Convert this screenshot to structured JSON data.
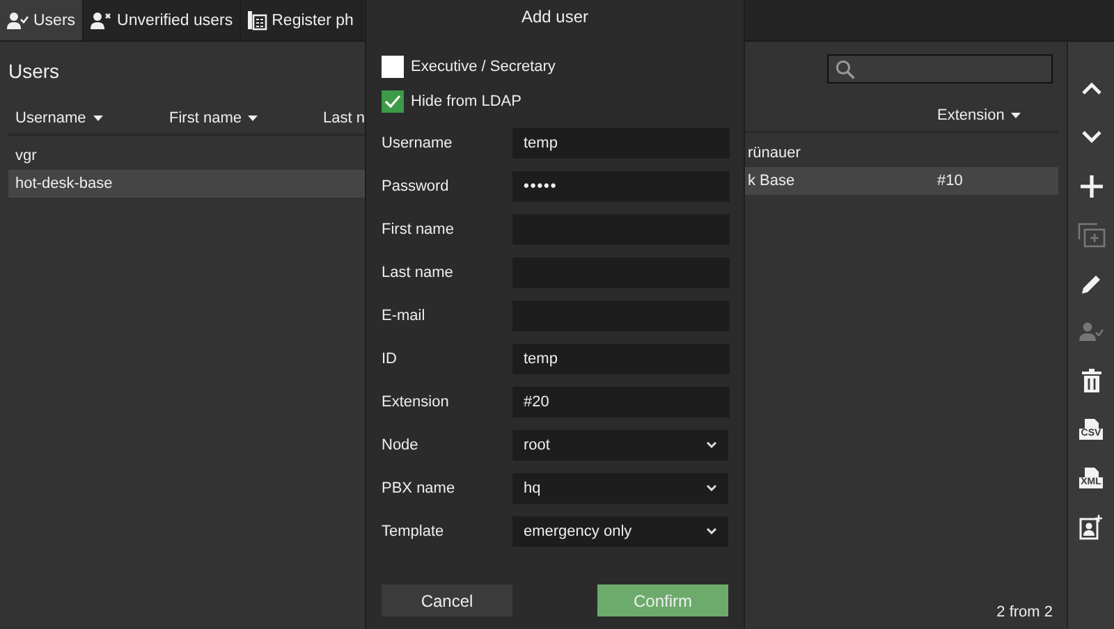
{
  "tabs": [
    {
      "label": "Users",
      "selected": true
    },
    {
      "label": "Unverified users",
      "selected": false
    },
    {
      "label": "Register ph",
      "selected": false
    }
  ],
  "page": {
    "title": "Users",
    "columns": [
      "Username",
      "First name",
      "Last n"
    ],
    "right_columns": [
      "Extension"
    ],
    "rows": [
      {
        "username": "vgr",
        "name_fragment": "rünauer",
        "selected": false
      },
      {
        "username": "hot-desk-base",
        "name_fragment": "k Base",
        "extension": "#10",
        "selected": true
      }
    ],
    "footer": "2 from 2"
  },
  "toolbar": [
    {
      "kind": "up",
      "disabled": false
    },
    {
      "kind": "down",
      "disabled": false
    },
    {
      "kind": "add",
      "disabled": false
    },
    {
      "kind": "duplicate",
      "disabled": true
    },
    {
      "kind": "edit",
      "disabled": false
    },
    {
      "kind": "verify",
      "disabled": true
    },
    {
      "kind": "delete",
      "disabled": false
    },
    {
      "kind": "file",
      "label": "CSV",
      "disabled": false
    },
    {
      "kind": "file",
      "label": "XML",
      "disabled": false
    },
    {
      "kind": "contact",
      "disabled": false
    }
  ],
  "dialog": {
    "title": "Add user",
    "checkboxes": [
      {
        "label": "Executive / Secretary",
        "checked": false
      },
      {
        "label": "Hide from LDAP",
        "checked": true
      }
    ],
    "fields": [
      {
        "label": "Username",
        "kind": "text",
        "value": "temp"
      },
      {
        "label": "Password",
        "kind": "password",
        "value": "•••••"
      },
      {
        "label": "First name",
        "kind": "text"
      },
      {
        "label": "Last name",
        "kind": "text"
      },
      {
        "label": "E-mail",
        "kind": "text"
      },
      {
        "label": "ID",
        "kind": "text",
        "value": "temp"
      },
      {
        "label": "Extension",
        "kind": "text",
        "value": "#20"
      },
      {
        "label": "Node",
        "kind": "select",
        "value": "root"
      },
      {
        "label": "PBX name",
        "kind": "select",
        "value": "hq"
      },
      {
        "label": "Template",
        "kind": "select",
        "value": "emergency only"
      }
    ],
    "buttons": [
      {
        "label": "Cancel",
        "kind": "secondary"
      },
      {
        "label": "Confirm",
        "kind": "primary"
      }
    ]
  }
}
